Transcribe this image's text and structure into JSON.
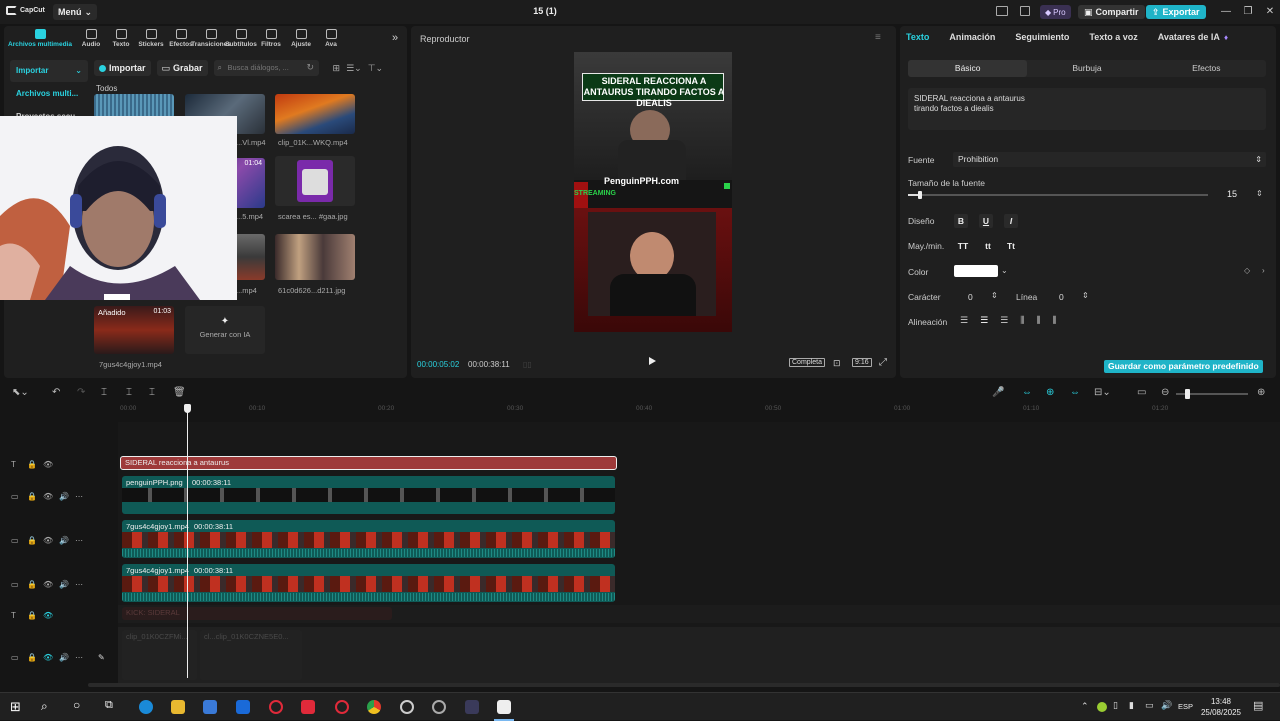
{
  "app": {
    "logo_text": "CapCut",
    "menu_label": "Menú",
    "project_title": "15 (1)",
    "pro_label": "Pro",
    "share_label": "Compartir",
    "export_label": "Exportar"
  },
  "toolbar_tabs": [
    {
      "label": "Archivos multimedia",
      "icon": "media-icon"
    },
    {
      "label": "Audio",
      "icon": "audio-icon"
    },
    {
      "label": "Texto",
      "icon": "text-icon"
    },
    {
      "label": "Stickers",
      "icon": "sticker-icon"
    },
    {
      "label": "Efectos",
      "icon": "effects-icon"
    },
    {
      "label": "Transiciones",
      "icon": "transition-icon"
    },
    {
      "label": "Subtítulos",
      "icon": "subtitle-icon"
    },
    {
      "label": "Filtros",
      "icon": "filter-icon"
    },
    {
      "label": "Ajuste",
      "icon": "adjust-icon"
    },
    {
      "label": "Ava",
      "icon": "avatar-icon"
    }
  ],
  "sidebar": {
    "items": [
      "Importar",
      "Archivos multi...",
      "Proyectos secu..."
    ]
  },
  "media": {
    "import_label": "Importar",
    "record_label": "Grabar",
    "search_placeholder": "Busca diálogos, ...",
    "todos_label": "Todos",
    "thumbs": [
      {
        "label": "...Vl.mp4"
      },
      {
        "label": "clip_01K...WKQ.mp4"
      },
      {
        "label": "...5.mp4",
        "duration": "01:04"
      },
      {
        "label": "scarea es... #gaa.jpg"
      },
      {
        "label": "...mp4"
      },
      {
        "label": "61c0d626...d211.jpg"
      },
      {
        "label": "7gus4c4gjoy1.mp4",
        "badge": "Añadido",
        "duration": "01:03"
      }
    ],
    "generate_label": "Generar con IA"
  },
  "player": {
    "title": "Reproductor",
    "current_time": "00:00:05:02",
    "total_time": "00:00:38:11",
    "complete_label": "Completa",
    "ratio_label": "9:16",
    "caption": "SIDERAL REACCIONA A ANTAURUS TIRANDO FACTOS A DIEALIS",
    "watermark": "PenguinPPH.com",
    "side_label": "STREAMING"
  },
  "props": {
    "tabs": [
      "Texto",
      "Animación",
      "Seguimiento",
      "Texto a voz",
      "Avatares de IA"
    ],
    "sub_tabs": [
      "Básico",
      "Burbuja",
      "Efectos"
    ],
    "text_content": "SIDERAL reacciona a antaurus\ntirando factos a diealis",
    "font_label": "Fuente",
    "font_value": "Prohibition",
    "size_label": "Tamaño de la fuente",
    "size_value": "15",
    "size_fraction": 0.04,
    "design_label": "Diseño",
    "bold": "B",
    "underline": "U",
    "italic": "I",
    "case_label": "May./min.",
    "case_upper": "TT",
    "case_lower": "tt",
    "case_title": "Tt",
    "color_label": "Color",
    "color_value": "#ffffff",
    "char_label": "Carácter",
    "char_value": "0",
    "line_label": "Línea",
    "line_value": "0",
    "align_label": "Alineación",
    "save_preset_label": "Guardar como parámetro predefinido"
  },
  "timeline": {
    "ruler": [
      "00:00",
      "00:10",
      "00:20",
      "00:30",
      "00:40",
      "00:50",
      "01:00",
      "01:10",
      "01:20"
    ],
    "playhead_seconds": 5.2,
    "clips": [
      {
        "label": "SIDERAL reacciona a antaurus",
        "track": 0
      },
      {
        "label": "penguinPPH.png",
        "duration": "00:00:38:11",
        "track": 1
      },
      {
        "label": "7gus4c4gjoy1.mp4",
        "duration": "00:00:38:11",
        "track": 2
      },
      {
        "label": "7gus4c4gjoy1.mp4",
        "duration": "00:00:38:11",
        "track": 3
      },
      {
        "label": "KICK: SIDERAL",
        "track": 4
      },
      {
        "label": "clip_01K0CZFMi...",
        "track": 5
      },
      {
        "label": "cl...clip_01K0CZNE5E0...",
        "track": 5
      }
    ]
  },
  "taskbar": {
    "lang": "ESP",
    "time": "13:48",
    "date": "25/08/2025"
  }
}
